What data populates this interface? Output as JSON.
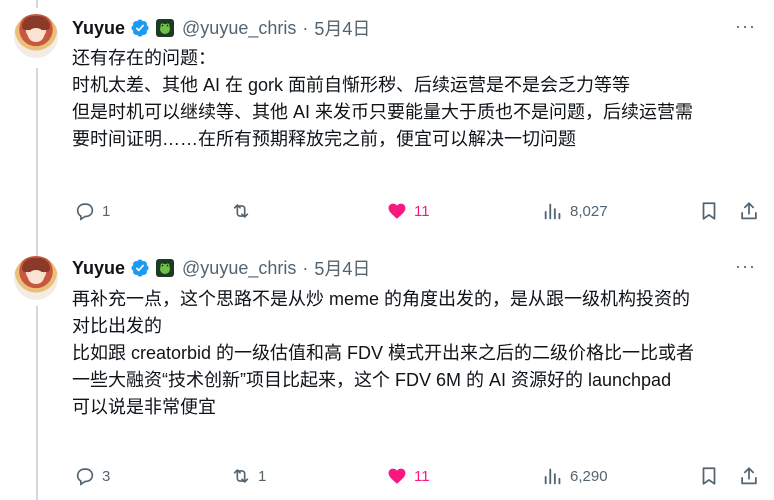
{
  "tweets": [
    {
      "author_name": "Yuyue",
      "handle": "@yuyue_chris",
      "separator": "·",
      "date": "5月4日",
      "more_label": "···",
      "lines": [
        "还有存在的问题：",
        "时机太差、其他 AI 在 gork 面前自惭形秽、后续运营是不是会乏力等等",
        "",
        "但是时机可以继续等、其他 AI 来发币只要能量大于质也不是问题，后续运营需",
        "要时间证明……在所有预期释放完之前，便宜可以解决一切问题"
      ],
      "replies": "1",
      "retweets": "",
      "likes": "11",
      "views": "8,027"
    },
    {
      "author_name": "Yuyue",
      "handle": "@yuyue_chris",
      "separator": "·",
      "date": "5月4日",
      "more_label": "···",
      "lines": [
        "再补充一点，这个思路不是从炒 meme 的角度出发的，是从跟一级机构投资的",
        "对比出发的",
        "",
        "比如跟 creatorbid 的一级估值和高 FDV 模式开出来之后的二级价格比一比或者",
        "一些大融资“技术创新”项目比起来，这个 FDV 6M 的 AI 资源好的 launchpad",
        "可以说是非常便宜"
      ],
      "replies": "3",
      "retweets": "1",
      "likes": "11",
      "views": "6,290"
    }
  ],
  "colors": {
    "text": "#0f1419",
    "secondary": "#536471",
    "verified": "#1d9bf0",
    "like": "#f91880",
    "thread_line": "#cfd9de"
  },
  "icons": [
    "verified-badge-icon",
    "frog-emoji-icon",
    "reply-icon",
    "retweet-icon",
    "heart-icon",
    "views-icon",
    "bookmark-icon",
    "share-icon",
    "more-icon"
  ]
}
